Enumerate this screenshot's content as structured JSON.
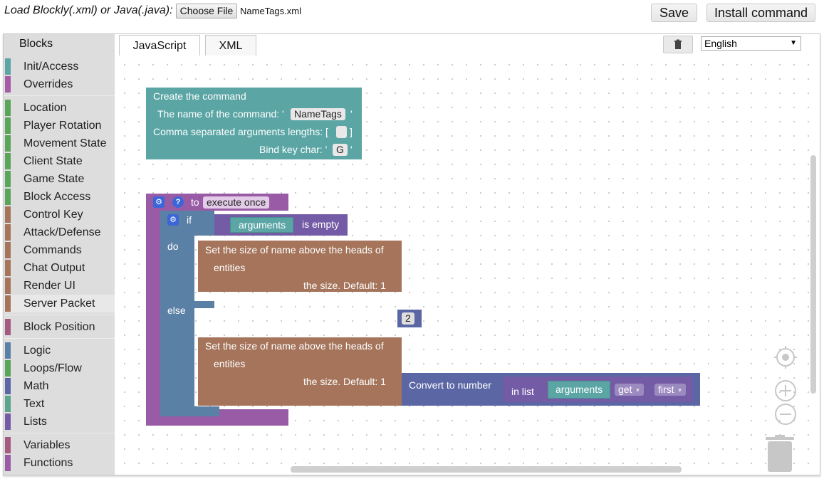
{
  "topbar": {
    "load_label": "Load Blockly(.xml) or Java(.java):",
    "choose_file": "Choose File",
    "file_name": "NameTags.xml",
    "save": "Save",
    "install": "Install command"
  },
  "toolbox": {
    "header": "Blocks",
    "groups": [
      [
        {
          "label": "Init/Access",
          "color": "#5ba5a5"
        },
        {
          "label": "Overrides",
          "color": "#a55ba5"
        }
      ],
      [
        {
          "label": "Location",
          "color": "#5ba55b"
        },
        {
          "label": "Player Rotation",
          "color": "#5ba55b"
        },
        {
          "label": "Movement State",
          "color": "#5ba55b"
        },
        {
          "label": "Client State",
          "color": "#5ba55b"
        },
        {
          "label": "Game State",
          "color": "#5ba55b"
        },
        {
          "label": "Block Access",
          "color": "#5ba55b"
        },
        {
          "label": "Control Key",
          "color": "#a5745b"
        },
        {
          "label": "Attack/Defense",
          "color": "#a5745b"
        },
        {
          "label": "Commands",
          "color": "#a5745b"
        },
        {
          "label": "Chat Output",
          "color": "#a5745b"
        },
        {
          "label": "Render UI",
          "color": "#a5745b"
        },
        {
          "label": "Server Packet",
          "color": "#a5745b",
          "selected": true
        }
      ],
      [
        {
          "label": "Block Position",
          "color": "#a55b80"
        }
      ],
      [
        {
          "label": "Logic",
          "color": "#5b80a5"
        },
        {
          "label": "Loops/Flow",
          "color": "#5ba55b"
        },
        {
          "label": "Math",
          "color": "#5b67a5"
        },
        {
          "label": "Text",
          "color": "#5ba58c"
        },
        {
          "label": "Lists",
          "color": "#745ba5"
        }
      ],
      [
        {
          "label": "Variables",
          "color": "#a55b80"
        },
        {
          "label": "Functions",
          "color": "#995ba5"
        }
      ]
    ]
  },
  "tabs": {
    "javascript": "JavaScript",
    "xml": "XML"
  },
  "language": {
    "selected": "English"
  },
  "blocks": {
    "create": {
      "title": "Create the command",
      "name_label": "The name of the command: '",
      "name_value": "NameTags",
      "quote": "'",
      "args_label": "Comma separated arguments lengths: [",
      "args_close": "]",
      "key_label": "Bind key char: '",
      "key_value": "G"
    },
    "func": {
      "to": "to",
      "name": "execute once",
      "if": "if",
      "do": "do",
      "else": "else",
      "arguments": "arguments",
      "is_empty": "is empty",
      "set_size_line1": "Set the size of name above the heads of",
      "set_size_line2": "entities",
      "size_default": "the size. Default: 1",
      "size_value_do": "2",
      "convert": "Convert to number",
      "in_list": "in list",
      "get": "get",
      "first": "first"
    }
  },
  "colors": {
    "teal": "#5ba5a5",
    "purple": "#995ba5",
    "steel": "#5b80a5",
    "brown": "#a5745b",
    "indigo": "#5b67a5",
    "list": "#745ba5"
  }
}
